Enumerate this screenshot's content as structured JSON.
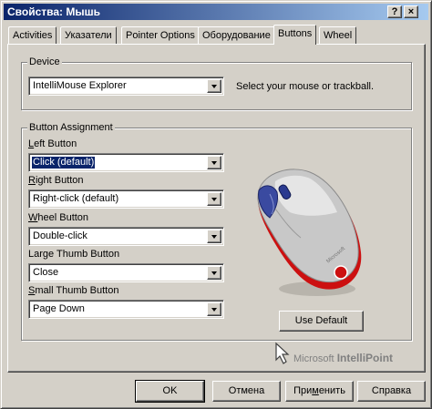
{
  "window": {
    "title": "Свойства: Мышь",
    "help_glyph": "?",
    "close_glyph": "×"
  },
  "tabs": [
    {
      "label": "Activities"
    },
    {
      "label": "Указатели"
    },
    {
      "label": "Pointer Options"
    },
    {
      "label": "Оборудование"
    },
    {
      "label": "Buttons",
      "active": true
    },
    {
      "label": "Wheel"
    }
  ],
  "device": {
    "legend": "Device",
    "value": "IntelliMouse Explorer",
    "hint": "Select your mouse or trackball."
  },
  "assignment": {
    "legend": "Button Assignment",
    "left": {
      "label_key": "L",
      "label_rest": "eft Button",
      "value": "Click (default)"
    },
    "right": {
      "label_key": "R",
      "label_rest": "ight Button",
      "value": "Right-click (default)"
    },
    "wheel": {
      "label_key": "W",
      "label_rest": "heel Button",
      "value": "Double-click"
    },
    "large_thumb": {
      "label": "Large Thumb Button",
      "value": "Close"
    },
    "small_thumb": {
      "label_key": "S",
      "label_rest": "mall Thumb Button",
      "value": "Page Down"
    },
    "use_default": "Use Default"
  },
  "brand": {
    "logo_text": "Microsoft",
    "name_light": "Microsoft ",
    "name_bold": "IntelliPoint"
  },
  "footer": {
    "ok": "OK",
    "cancel": "Отмена",
    "apply_key": "м",
    "apply_pre": "При",
    "apply_post": "енить",
    "help": "Справка"
  },
  "colors": {
    "title_start": "#0a246a",
    "title_end": "#a6caf0",
    "selection": "#0a246a",
    "mouse_body": "#c8c8c8",
    "mouse_accent": "#cc1010"
  }
}
